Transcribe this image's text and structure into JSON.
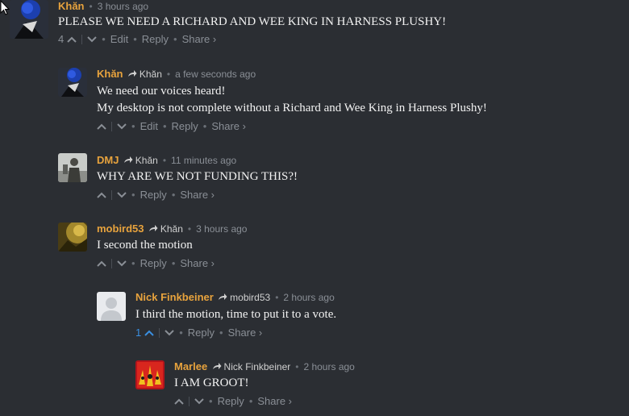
{
  "comments": [
    {
      "author": "Khăn",
      "time": "3 hours ago",
      "text": "PLEASE WE NEED A RICHARD AND WEE KING IN HARNESS PLUSHY!",
      "votes": "4",
      "actions": {
        "edit": "Edit",
        "reply": "Reply",
        "share": "Share ›"
      }
    },
    {
      "author": "Khăn",
      "reply_to": "Khăn",
      "time": "a few seconds ago",
      "line1": "We need our voices heard!",
      "line2": "My desktop is not complete without a Richard and Wee King in Harness Plushy!",
      "actions": {
        "edit": "Edit",
        "reply": "Reply",
        "share": "Share ›"
      }
    },
    {
      "author": "DMJ",
      "reply_to": "Khăn",
      "time": "11 minutes ago",
      "text": "WHY ARE WE NOT FUNDING THIS?!",
      "actions": {
        "reply": "Reply",
        "share": "Share ›"
      }
    },
    {
      "author": "mobird53",
      "reply_to": "Khăn",
      "time": "3 hours ago",
      "text": "I second the motion",
      "actions": {
        "reply": "Reply",
        "share": "Share ›"
      }
    },
    {
      "author": "Nick Finkbeiner",
      "reply_to": "mobird53",
      "time": "2 hours ago",
      "text": "I third the motion, time to put it to a vote.",
      "votes": "1",
      "actions": {
        "reply": "Reply",
        "share": "Share ›"
      }
    },
    {
      "author": "Marlee",
      "reply_to": "Nick Finkbeiner",
      "time": "2 hours ago",
      "text": "I AM GROOT!",
      "actions": {
        "reply": "Reply",
        "share": "Share ›"
      }
    }
  ],
  "colors": {
    "background": "#2b2e33",
    "author": "#e8a33d",
    "accent_blue": "#3a8fe0"
  },
  "icons": [
    "cursor-icon",
    "reply-arrow-icon",
    "upvote-icon",
    "downvote-icon"
  ]
}
